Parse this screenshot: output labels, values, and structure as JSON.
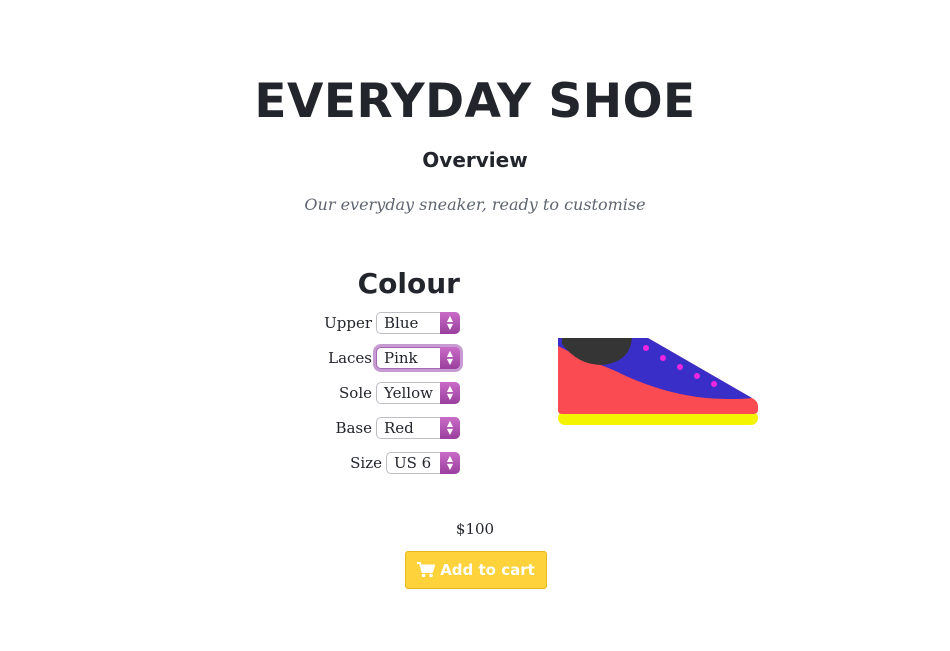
{
  "product": {
    "title": "EVERYDAY SHOE",
    "subtitle": "Overview",
    "tagline": "Our everyday sneaker, ready to customise"
  },
  "colour": {
    "heading": "Colour",
    "options": [
      {
        "label": "Upper",
        "value": "Blue"
      },
      {
        "label": "Laces",
        "value": "Pink"
      },
      {
        "label": "Sole",
        "value": "Yellow"
      },
      {
        "label": "Base",
        "value": "Red"
      },
      {
        "label": "Size",
        "value": "US 6"
      }
    ]
  },
  "shoe_colors": {
    "upper": "#3a2ec8",
    "laces": "#f226e0",
    "sole": "#f4f400",
    "base": "#fa4a52",
    "collar": "#353535"
  },
  "price": "$100",
  "cart": {
    "label": "Add to cart",
    "icon": "cart-icon",
    "color": "#fdd23b"
  }
}
